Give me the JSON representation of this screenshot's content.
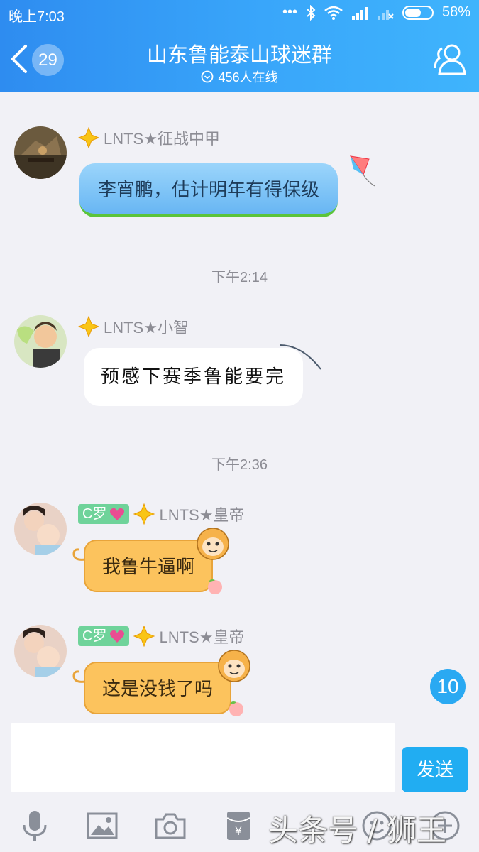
{
  "status_bar": {
    "time": "晚上7:03",
    "battery": "58%"
  },
  "header": {
    "back_count": "29",
    "title": "山东鲁能泰山球迷群",
    "online": "456人在线"
  },
  "messages": [
    {
      "sender": "LNTS★征战中甲",
      "text": "李宵鹏，估计明年有得保级"
    },
    {
      "timestamp": "下午2:14",
      "sender": "LNTS★小智",
      "text": "预感下赛季鲁能要完"
    },
    {
      "timestamp": "下午2:36",
      "tag": "C罗",
      "sender": "LNTS★皇帝",
      "text": "我鲁牛逼啊"
    },
    {
      "tag": "C罗",
      "sender": "LNTS★皇帝",
      "text": "这是没钱了吗"
    }
  ],
  "unread_count": "10",
  "input": {
    "send_label": "发送"
  },
  "watermark": "头条号 / 狮王",
  "colors": {
    "header": "#39a6fa",
    "send": "#21adf2",
    "bubble_orange": "#fcc35d"
  }
}
